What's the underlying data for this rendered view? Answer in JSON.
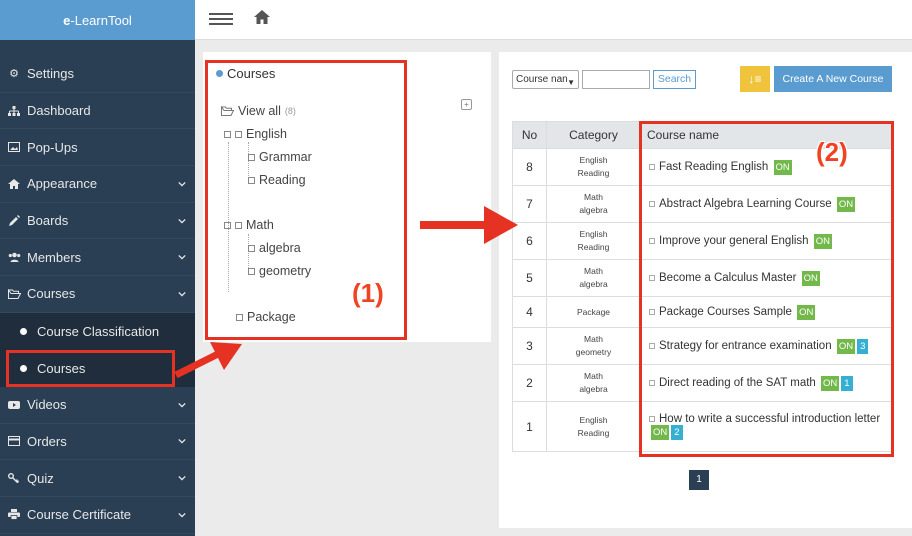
{
  "brand": {
    "prefix": "e",
    "suffix": "-LearnTool"
  },
  "sidebar": {
    "items": [
      {
        "label": "Settings",
        "icon": "gears-icon",
        "chevron": false
      },
      {
        "label": "Dashboard",
        "icon": "sitemap-icon",
        "chevron": false
      },
      {
        "label": "Pop-Ups",
        "icon": "image-icon",
        "chevron": false
      },
      {
        "label": "Appearance",
        "icon": "home-icon",
        "chevron": true
      },
      {
        "label": "Boards",
        "icon": "pencil-icon",
        "chevron": true
      },
      {
        "label": "Members",
        "icon": "users-icon",
        "chevron": true
      },
      {
        "label": "Courses",
        "icon": "folder-open-icon",
        "chevron": true
      },
      {
        "label": "Videos",
        "icon": "video-icon",
        "chevron": true
      },
      {
        "label": "Orders",
        "icon": "credit-card-icon",
        "chevron": true
      },
      {
        "label": "Quiz",
        "icon": "key-icon",
        "chevron": true
      },
      {
        "label": "Course Certificate",
        "icon": "print-icon",
        "chevron": true
      }
    ],
    "courses_sub": [
      {
        "label": "Course Classification"
      },
      {
        "label": "Courses"
      }
    ]
  },
  "tree": {
    "title": "Courses",
    "view_all": "View all",
    "view_all_count": "(8)",
    "nodes": {
      "english": "English",
      "grammar": "Grammar",
      "reading": "Reading",
      "math": "Math",
      "algebra": "algebra",
      "geometry": "geometry",
      "package": "Package"
    },
    "expand_symbol": "+"
  },
  "filter": {
    "select_value": "Course nan",
    "search_label": "Search",
    "sort_symbol": "↓≡",
    "create_label": "Create A New Course"
  },
  "table": {
    "headers": {
      "no": "No",
      "category": "Category",
      "name": "Course name"
    },
    "rows": [
      {
        "no": "8",
        "cat1": "English",
        "cat2": "Reading",
        "name": "Fast Reading English",
        "status": "ON",
        "count": ""
      },
      {
        "no": "7",
        "cat1": "Math",
        "cat2": "algebra",
        "name": "Abstract Algebra Learning Course",
        "status": "ON",
        "count": ""
      },
      {
        "no": "6",
        "cat1": "English",
        "cat2": "Reading",
        "name": "Improve your general English",
        "status": "ON",
        "count": ""
      },
      {
        "no": "5",
        "cat1": "Math",
        "cat2": "algebra",
        "name": "Become a Calculus Master",
        "status": "ON",
        "count": ""
      },
      {
        "no": "4",
        "cat1": "Package",
        "cat2": "",
        "name": "Package Courses Sample",
        "status": "ON",
        "count": ""
      },
      {
        "no": "3",
        "cat1": "Math",
        "cat2": "geometry",
        "name": "Strategy for entrance examination",
        "status": "ON",
        "count": "3"
      },
      {
        "no": "2",
        "cat1": "Math",
        "cat2": "algebra",
        "name": "Direct reading of the SAT math",
        "status": "ON",
        "count": "1"
      },
      {
        "no": "1",
        "cat1": "English",
        "cat2": "Reading",
        "name": "How to write a successful introduction letter",
        "status": "ON",
        "count": "2"
      }
    ]
  },
  "pager": {
    "current": "1"
  },
  "annotations": {
    "label1": "(1)",
    "label2": "(2)",
    "color": "#e53222"
  },
  "colors": {
    "sidebar": "#2a3f54",
    "brand": "#5a9bd0",
    "on_tag": "#73b84b",
    "count_tag": "#35b0d3",
    "sort_btn": "#f0c33c"
  }
}
